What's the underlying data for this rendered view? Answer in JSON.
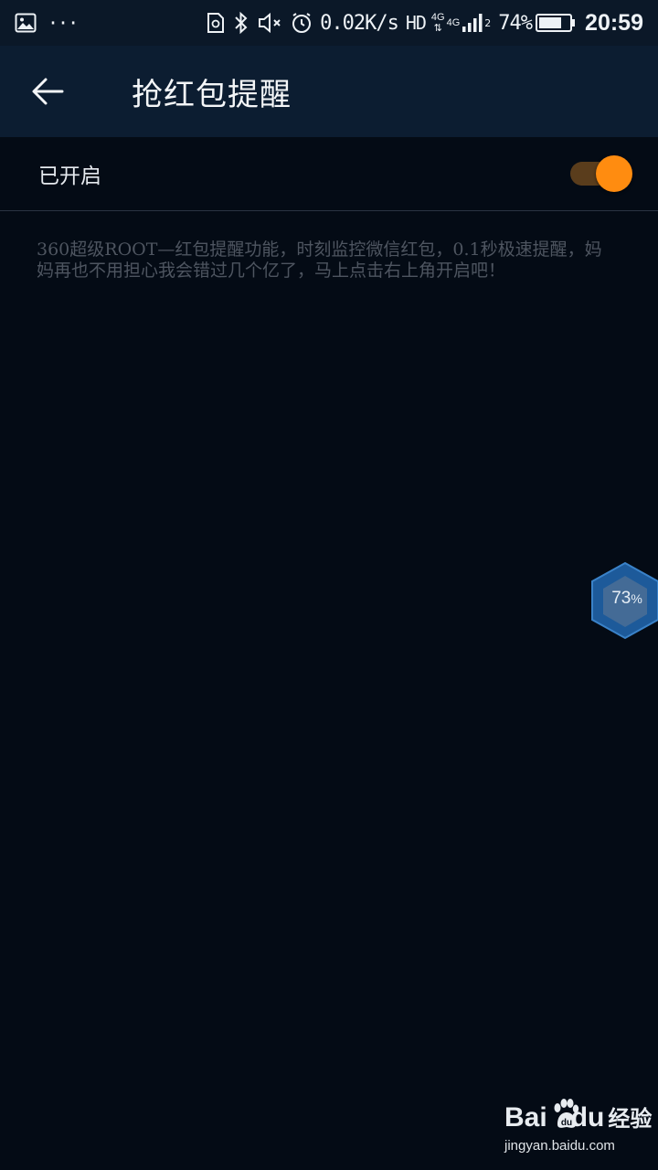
{
  "status_bar": {
    "left_icons": [
      "image-icon",
      "more-dots-icon"
    ],
    "more_text": "···",
    "icons": [
      "sim-icon",
      "bluetooth-icon",
      "mute-icon",
      "alarm-icon"
    ],
    "net_speed": "0.02K/s",
    "hd": "HD",
    "network": "4G",
    "network2": "4G",
    "sim2": "2",
    "battery_percent": "74%",
    "battery_level": 0.74,
    "time": "20:59"
  },
  "header": {
    "title": "抢红包提醒",
    "back_icon": "arrow-left-icon"
  },
  "setting": {
    "label": "已开启",
    "enabled": true,
    "accent": "#ff8c10"
  },
  "description": "360超级ROOT—红包提醒功能，时刻监控微信红包，0.1秒极速提醒，妈妈再也不用担心我会错过几个亿了，马上点击右上角开启吧！",
  "float_ball": {
    "value": "73",
    "unit": "%"
  },
  "watermark": {
    "brand": "Bai",
    "brand_tail": "du",
    "brand_cn": "经验",
    "url": "jingyan.baidu.com"
  }
}
